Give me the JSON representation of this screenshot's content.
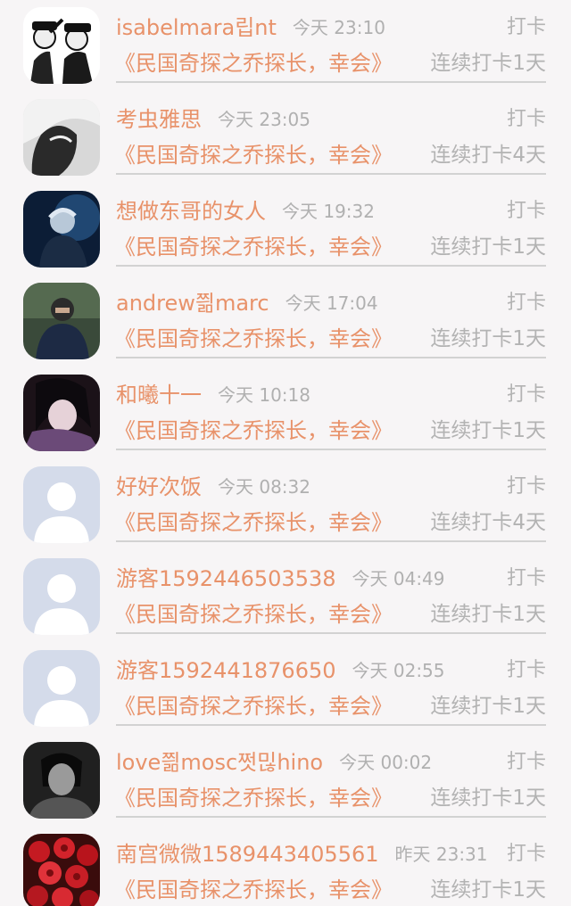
{
  "entries": [
    {
      "name": "isabelmara립nt",
      "time": "今天 23:10",
      "checkin": "打卡",
      "book": "《民国奇探之乔探长，幸会》",
      "streak": "连续打卡1天",
      "avatar": "photo-police"
    },
    {
      "name": "考虫雅思",
      "time": "今天 23:05",
      "checkin": "打卡",
      "book": "《民国奇探之乔探长，幸会》",
      "streak": "连续打卡4天",
      "avatar": "photo-sketch"
    },
    {
      "name": "想做东哥的女人",
      "time": "今天 19:32",
      "checkin": "打卡",
      "book": "《民国奇探之乔探长，幸会》",
      "streak": "连续打卡1天",
      "avatar": "photo-blue"
    },
    {
      "name": "andrew쯺marc",
      "time": "今天 17:04",
      "checkin": "打卡",
      "book": "《民国奇探之乔探长，幸会》",
      "streak": "连续打卡1天",
      "avatar": "photo-person"
    },
    {
      "name": "和曦十一",
      "time": "今天 10:18",
      "checkin": "打卡",
      "book": "《民国奇探之乔探长，幸会》",
      "streak": "连续打卡1天",
      "avatar": "photo-anime"
    },
    {
      "name": "好好次饭",
      "time": "今天 08:32",
      "checkin": "打卡",
      "book": "《民国奇探之乔探长，幸会》",
      "streak": "连续打卡4天",
      "avatar": "default"
    },
    {
      "name": "游客1592446503538",
      "time": "今天 04:49",
      "checkin": "打卡",
      "book": "《民国奇探之乔探长，幸会》",
      "streak": "连续打卡1天",
      "avatar": "default"
    },
    {
      "name": "游客1592441876650",
      "time": "今天 02:55",
      "checkin": "打卡",
      "book": "《民国奇探之乔探长，幸会》",
      "streak": "连续打卡1天",
      "avatar": "default"
    },
    {
      "name": "love쯺mosc쩟믾hino",
      "time": "今天 00:02",
      "checkin": "打卡",
      "book": "《民国奇探之乔探长，幸会》",
      "streak": "连续打卡1天",
      "avatar": "photo-bw"
    },
    {
      "name": "南宫微微1589443405561",
      "time": "昨天 23:31",
      "checkin": "打卡",
      "book": "《民国奇探之乔探长，幸会》",
      "streak": "连续打卡1天",
      "avatar": "photo-roses"
    }
  ],
  "colors": {
    "accent": "#e8926a",
    "muted": "#b3b3b3",
    "divider": "#d2d2d2",
    "background": "#f7f5f6"
  }
}
